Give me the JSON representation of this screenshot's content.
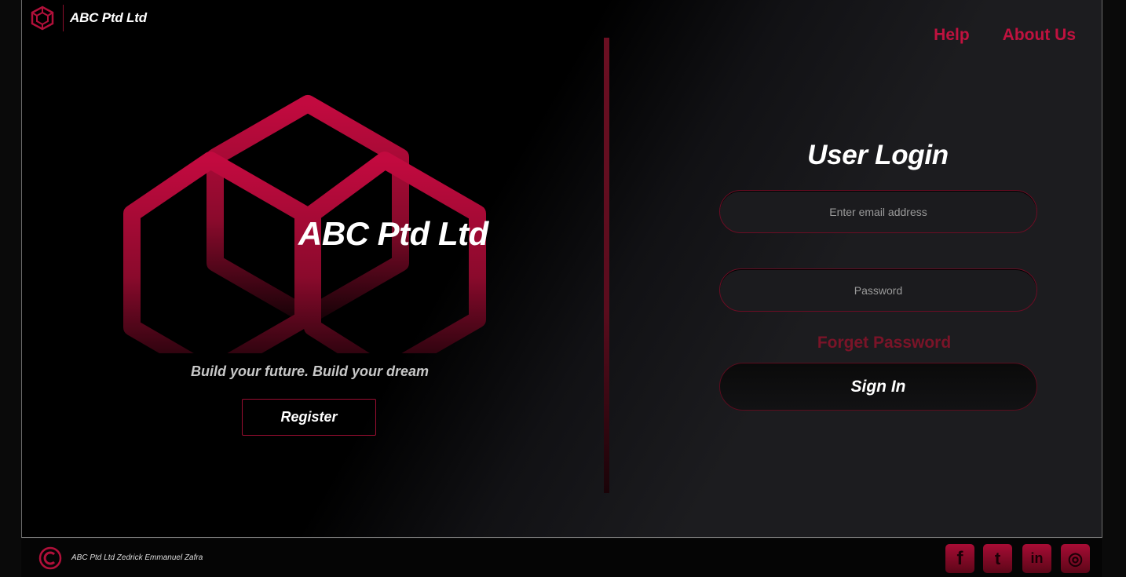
{
  "brand": {
    "name": "ABC Ptd Ltd",
    "logo_icon": "cube-grid-icon"
  },
  "nav": {
    "help": "Help",
    "about": "About Us"
  },
  "hero": {
    "logo_text": "ABC Ptd Ltd",
    "tagline": "Build your future. Build your dream",
    "register_label": "Register"
  },
  "login": {
    "title": "User Login",
    "email_placeholder": "Enter email address",
    "password_placeholder": "Password",
    "forgot_label": "Forget Password",
    "signin_label": "Sign In"
  },
  "footer": {
    "text": "ABC Ptd Ltd Zedrick Emmanuel Zafra",
    "copyright_icon": "copyright-icon",
    "social": [
      {
        "name": "facebook-icon",
        "glyph": "f"
      },
      {
        "name": "twitter-icon",
        "glyph": "t"
      },
      {
        "name": "linkedin-icon",
        "glyph": "in"
      },
      {
        "name": "instagram-icon",
        "glyph": "◎"
      }
    ]
  },
  "colors": {
    "accent": "#c0123f",
    "accent_dark": "#6b0f22",
    "background": "#000000",
    "panel": "#1c1c1f"
  }
}
